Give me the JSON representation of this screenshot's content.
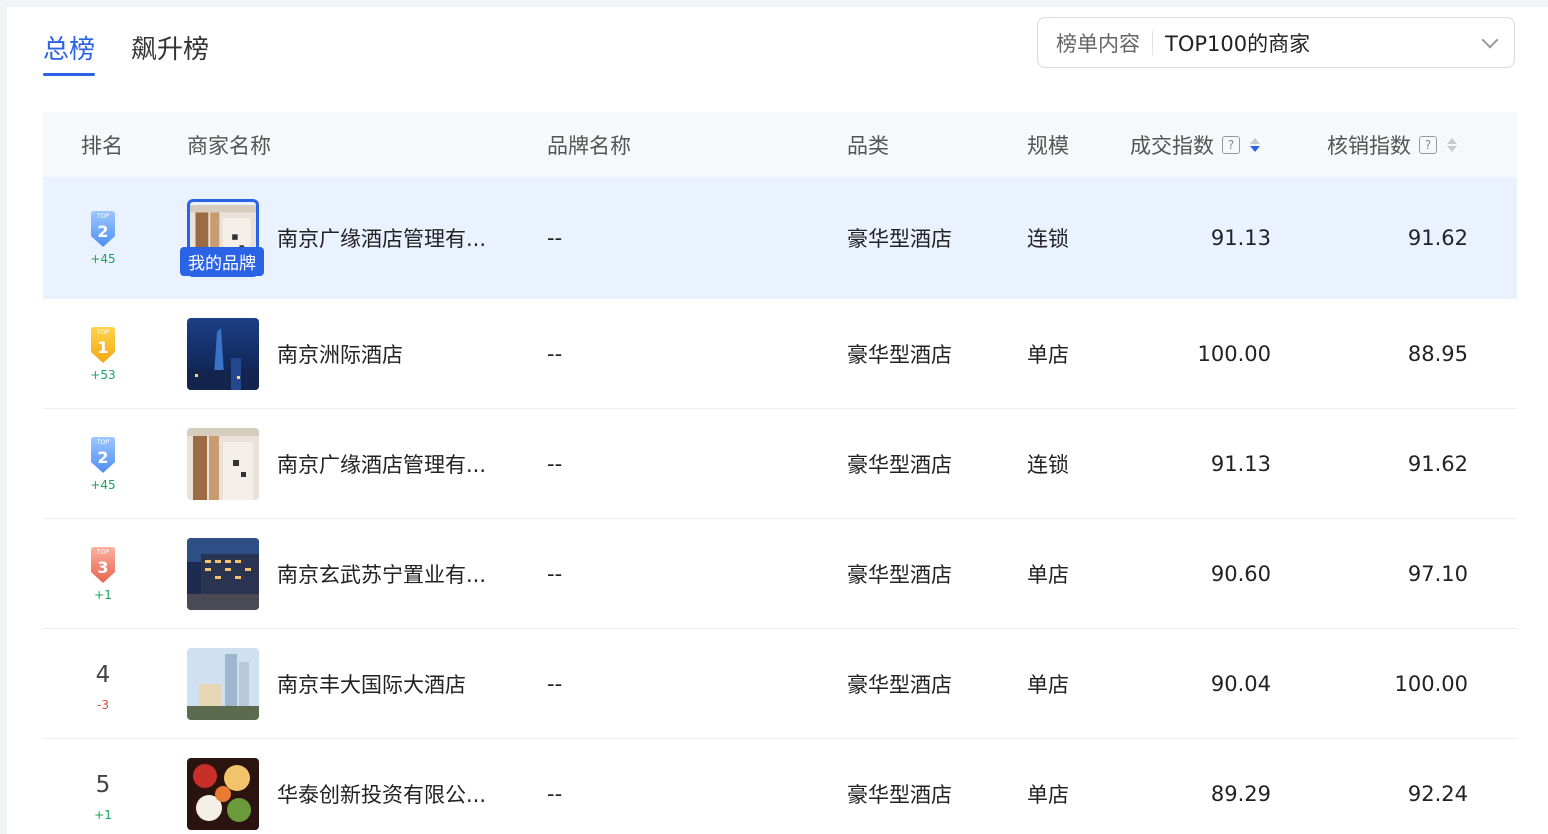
{
  "tabs": [
    {
      "label": "总榜",
      "active": true
    },
    {
      "label": "飙升榜",
      "active": false
    }
  ],
  "filter": {
    "label": "榜单内容",
    "value": "TOP100的商家"
  },
  "columns": {
    "rank": "排名",
    "merchant": "商家名称",
    "brand": "品牌名称",
    "category": "品类",
    "scale": "规模",
    "deal_index": "成交指数",
    "verify_index": "核销指数"
  },
  "my_brand_tag": "我的品牌",
  "rows": [
    {
      "rank": "2",
      "medal": "silver",
      "delta": "+45",
      "dir": "up",
      "name": "南京广缘酒店管理有...",
      "brand": "--",
      "category": "豪华型酒店",
      "scale": "连锁",
      "deal": "91.13",
      "verify": "91.62",
      "mine": true,
      "img": "interior"
    },
    {
      "rank": "1",
      "medal": "gold",
      "delta": "+53",
      "dir": "up",
      "name": "南京洲际酒店",
      "brand": "--",
      "category": "豪华型酒店",
      "scale": "单店",
      "deal": "100.00",
      "verify": "88.95",
      "mine": false,
      "img": "tower"
    },
    {
      "rank": "2",
      "medal": "silver",
      "delta": "+45",
      "dir": "up",
      "name": "南京广缘酒店管理有...",
      "brand": "--",
      "category": "豪华型酒店",
      "scale": "连锁",
      "deal": "91.13",
      "verify": "91.62",
      "mine": false,
      "img": "interior"
    },
    {
      "rank": "3",
      "medal": "bronze",
      "delta": "+1",
      "dir": "up",
      "name": "南京玄武苏宁置业有...",
      "brand": "--",
      "category": "豪华型酒店",
      "scale": "单店",
      "deal": "90.60",
      "verify": "97.10",
      "mine": false,
      "img": "night"
    },
    {
      "rank": "4",
      "medal": "",
      "delta": "-3",
      "dir": "down",
      "name": "南京丰大国际大酒店",
      "brand": "--",
      "category": "豪华型酒店",
      "scale": "单店",
      "deal": "90.04",
      "verify": "100.00",
      "mine": false,
      "img": "skyline"
    },
    {
      "rank": "5",
      "medal": "",
      "delta": "+1",
      "dir": "up",
      "name": "华泰创新投资有限公...",
      "brand": "--",
      "category": "豪华型酒店",
      "scale": "单店",
      "deal": "89.29",
      "verify": "92.24",
      "mine": false,
      "img": "food"
    }
  ]
}
